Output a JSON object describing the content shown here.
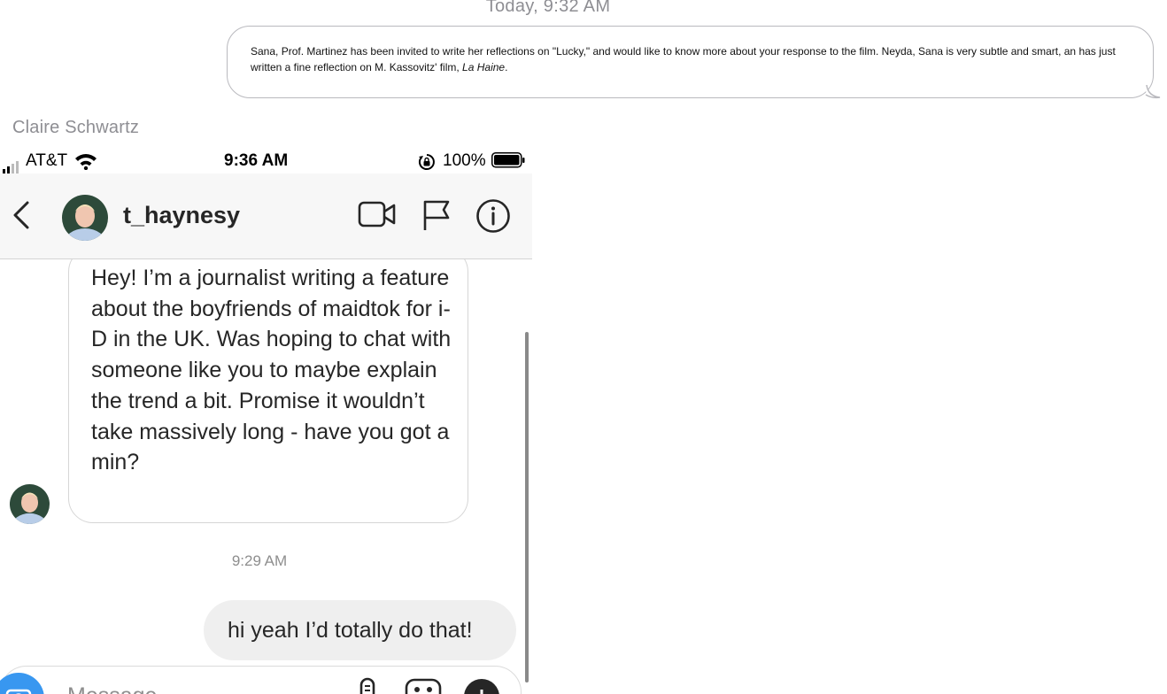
{
  "top": {
    "timestamp": "Today, 9:32 AM",
    "message": "Sana, Prof. Martinez has been invited to write her reflections on \"Lucky,\" and would like to know more about your response to the film. Neyda, Sana is very subtle and smart, an has just written a fine reflection on M. Kassovitz' film, ",
    "message_italic": "La Haine",
    "message_end": ".",
    "sender": "Claire Schwartz"
  },
  "status_bar": {
    "carrier": "AT&T",
    "time": "9:36 AM",
    "battery": "100%"
  },
  "header": {
    "username": "t_haynesy"
  },
  "conversation": {
    "received_message": "Hey! I’m a journalist writing a feature about the boyfriends of maidtok for i-D in the UK. Was hoping to chat with someone like you to maybe explain the trend a bit. Promise it wouldn’t take massively long - have you got a min?",
    "timestamp": "9:29 AM",
    "sent_message": "hi yeah I’d totally do that!"
  },
  "composer": {
    "placeholder": "Message..."
  },
  "icons": [
    "signal-icon",
    "wifi-icon",
    "orientation-lock-icon",
    "battery-icon",
    "back-chevron-icon",
    "video-call-icon",
    "flag-icon",
    "info-icon",
    "camera-icon",
    "microphone-icon",
    "image-icon",
    "sticker-icon"
  ],
  "colors": {
    "accent": "#3897f0",
    "sent_bubble": "#efefef",
    "muted_text": "#8e8e8e"
  }
}
